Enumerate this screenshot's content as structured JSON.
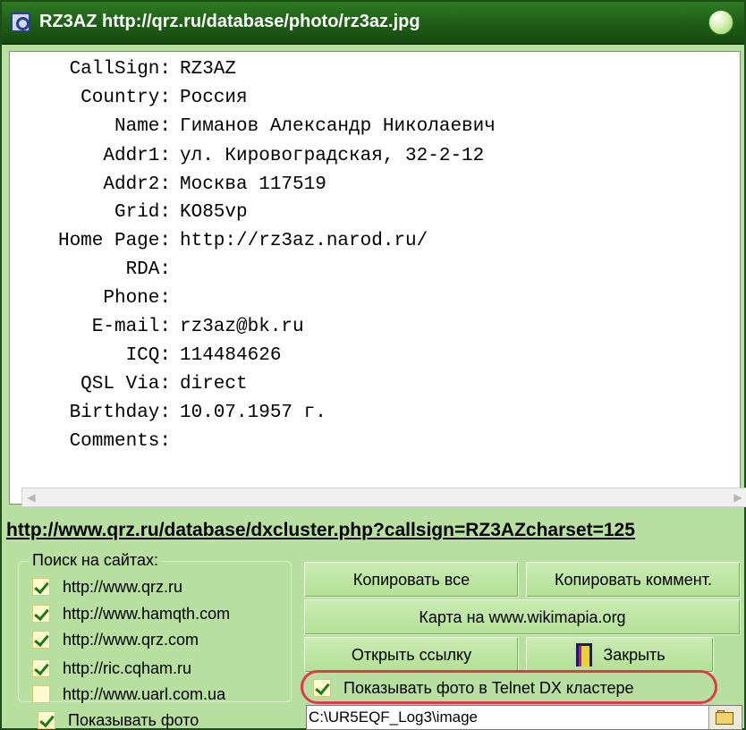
{
  "window": {
    "title": "RZ3AZ http://qrz.ru/database/photo/rz3az.jpg"
  },
  "info": {
    "rows": [
      {
        "key": "CallSign:",
        "value": "RZ3AZ"
      },
      {
        "key": "Country:",
        "value": "Россия"
      },
      {
        "key": "Name:",
        "value": "Гиманов Александр Николаевич"
      },
      {
        "key": "Addr1:",
        "value": "ул. Кировоградская, 32-2-12"
      },
      {
        "key": "Addr2:",
        "value": "Москва 117519"
      },
      {
        "key": "Grid:",
        "value": "KO85vp"
      },
      {
        "key": "Home Page:",
        "value": "http://rz3az.narod.ru/"
      },
      {
        "key": "RDA:",
        "value": ""
      },
      {
        "key": "Phone:",
        "value": ""
      },
      {
        "key": "E-mail:",
        "value": "rz3az@bk.ru"
      },
      {
        "key": "ICQ:",
        "value": "114484626"
      },
      {
        "key": "QSL Via:",
        "value": "direct"
      },
      {
        "key": "Birthday:",
        "value": "10.07.1957 г."
      },
      {
        "key": "Comments:",
        "value": ""
      }
    ]
  },
  "cluster_link": "http://www.qrz.ru/database/dxcluster.php?callsign=RZ3AZcharset=125",
  "search_group": {
    "title": "Поиск на сайтах:",
    "sites": [
      {
        "label": "http://www.qrz.ru",
        "checked": true
      },
      {
        "label": "http://www.hamqth.com",
        "checked": true
      },
      {
        "label": "http://www.qrz.com",
        "checked": true
      },
      {
        "label": "http://ric.cqham.ru",
        "checked": true
      },
      {
        "label": "http://www.uarl.com.ua",
        "checked": false
      }
    ]
  },
  "buttons": {
    "copy_all": "Копировать все",
    "copy_comment": "Копировать коммент.",
    "wikimapia": "Карта на www.wikimapia.org",
    "open_link": "Открыть ссылку",
    "close": "Закрыть"
  },
  "options": {
    "telnet_photo": {
      "label": "Показывать фото в Telnet DX кластере",
      "checked": true
    },
    "show_photo": {
      "label": "Показывать фото",
      "checked": true
    }
  },
  "image_path": "C:\\UR5EQF_Log3\\image"
}
